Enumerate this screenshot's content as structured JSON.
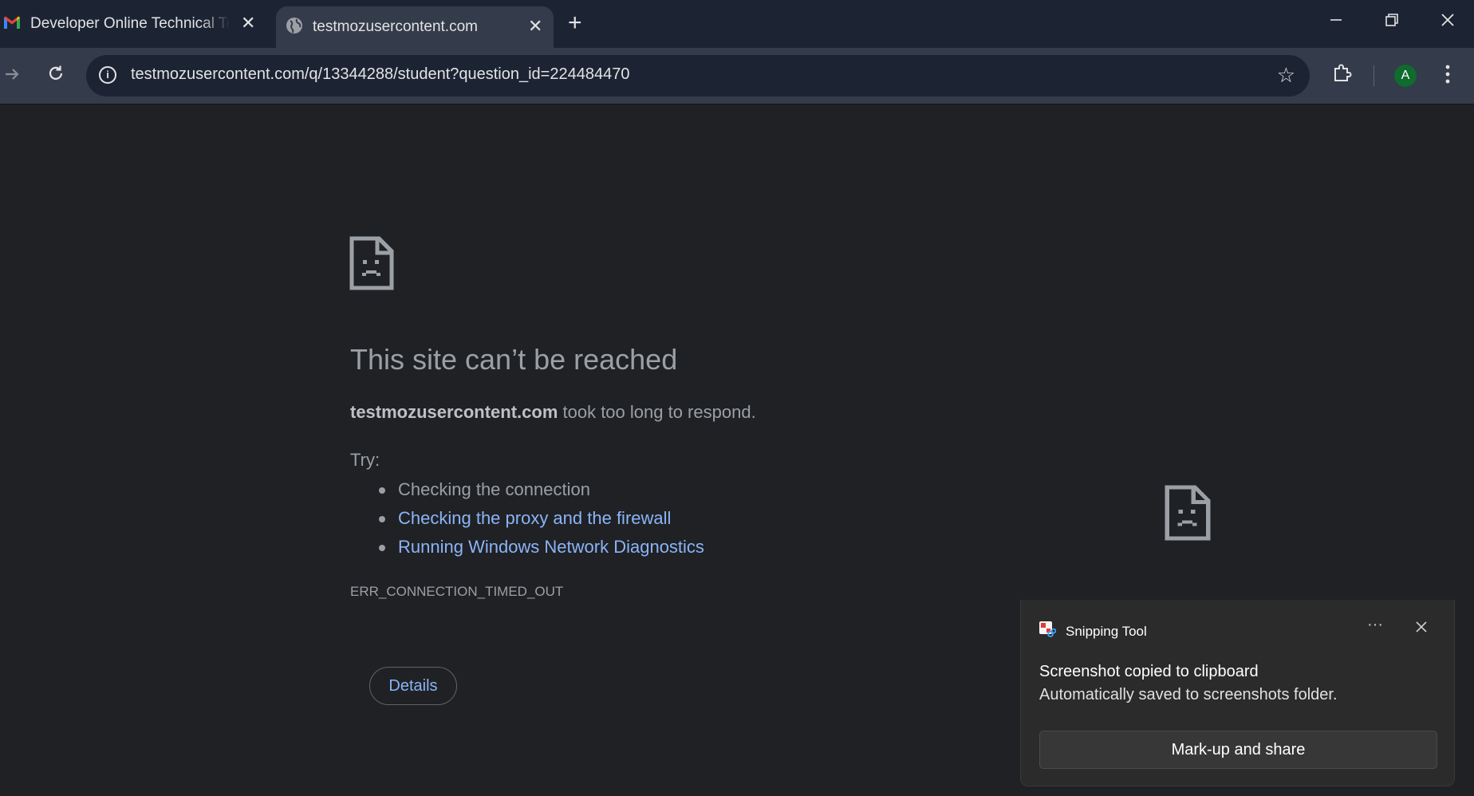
{
  "browser": {
    "tabs": [
      {
        "title": "Developer Online Technical Test",
        "favicon": "gmail-icon"
      },
      {
        "title": "testmozusercontent.com",
        "favicon": "globe-icon",
        "active": true
      }
    ],
    "address_bar": {
      "url": "testmozusercontent.com/q/13344288/student?question_id=224484470"
    },
    "profile_initial": "A"
  },
  "error_page": {
    "heading": "This site can’t be reached",
    "host": "testmozusercontent.com",
    "message_suffix": " took too long to respond.",
    "try_label": "Try:",
    "suggestions": [
      "Checking the connection",
      "Checking the proxy and the firewall",
      "Running Windows Network Diagnostics"
    ],
    "error_code": "ERR_CONNECTION_TIMED_OUT",
    "details_button": "Details"
  },
  "notification": {
    "app_name": "Snipping Tool",
    "title": "Screenshot copied to clipboard",
    "body": "Automatically saved to screenshots folder.",
    "action_button": "Mark-up and share"
  },
  "colors": {
    "accent_link": "#8ab4f8",
    "page_bg": "#202124",
    "chrome_frame": "#1c2434"
  }
}
